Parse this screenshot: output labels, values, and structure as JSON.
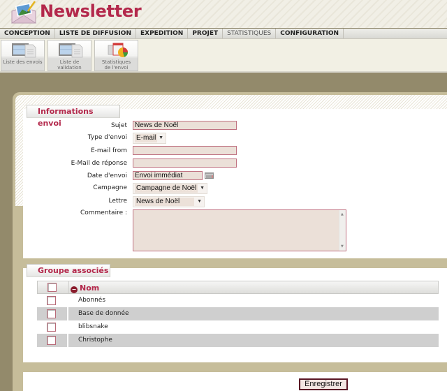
{
  "app": {
    "title": "Newsletter",
    "logo_icon": "envelope-image-icon"
  },
  "menu": {
    "items": [
      {
        "label": "CONCEPTION"
      },
      {
        "label": "LISTE DE DIFFUSION"
      },
      {
        "label": "EXPEDITION"
      },
      {
        "label": "PROJET"
      },
      {
        "label": "STATISTIQUES",
        "active": true
      },
      {
        "label": "CONFIGURATION"
      }
    ]
  },
  "toolbar": {
    "buttons": [
      {
        "label": "Liste des envois",
        "icon": "window-list-icon"
      },
      {
        "label": "Liste de validation",
        "icon": "window-list-icon"
      },
      {
        "label": "Statistiques de l'envoi",
        "icon": "pie-chart-icon"
      }
    ]
  },
  "info_section": {
    "title": "Informations envoi",
    "fields": {
      "sujet": {
        "label": "Sujet",
        "value": "News de Noël"
      },
      "type_envoi": {
        "label": "Type d'envoi",
        "value": "E-mail"
      },
      "email_from": {
        "label": "E-mail from",
        "value": ""
      },
      "email_reponse": {
        "label": "E-Mail de réponse",
        "value": ""
      },
      "date_envoi": {
        "label": "Date d'envoi",
        "value": "Envoi immédiat",
        "icon": "calendar-icon"
      },
      "campagne": {
        "label": "Campagne",
        "value": "Campagne de Noël"
      },
      "lettre": {
        "label": "Lettre",
        "value": "News de Noël"
      },
      "commentaire": {
        "label": "Commentaire :",
        "value": ""
      }
    }
  },
  "groups_section": {
    "title": "Groupe associés",
    "column_header": "Nom",
    "sort_icon": "sort-minus-icon",
    "rows": [
      {
        "name": "Abonnés",
        "checked": false
      },
      {
        "name": "Base de donnée",
        "checked": false
      },
      {
        "name": "blibsnake",
        "checked": false
      },
      {
        "name": "Christophe",
        "checked": false
      }
    ]
  },
  "actions": {
    "save_label": "Enregistrer"
  },
  "colors": {
    "brand": "#b3284b",
    "frame": "#938a6b",
    "band": "#c6bd9a",
    "input_bg": "#ebe0d8",
    "input_border": "#c07282"
  }
}
